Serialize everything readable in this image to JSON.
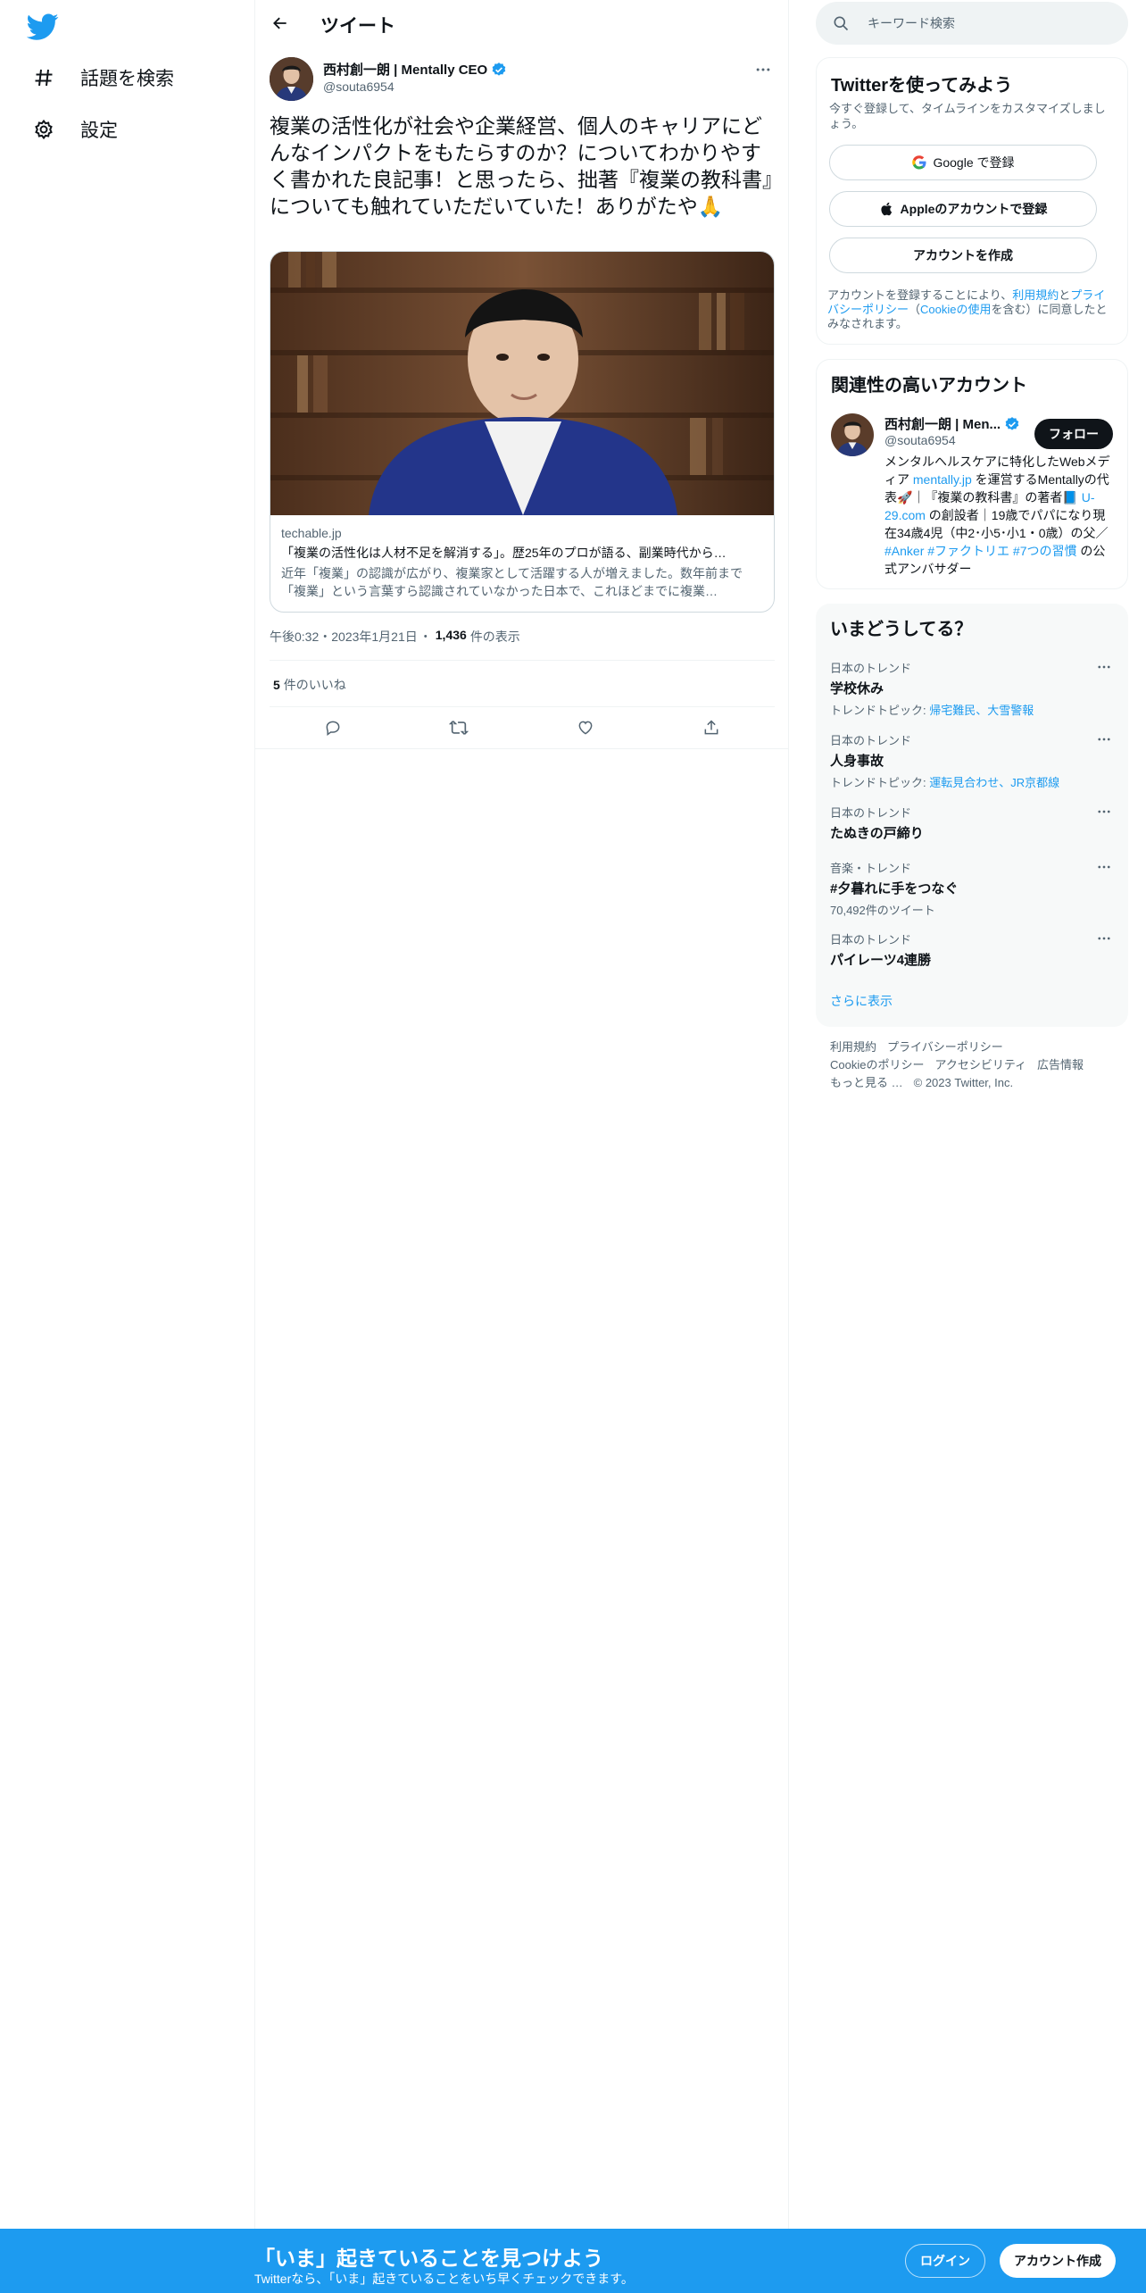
{
  "colors": {
    "accent": "#1d9bf0",
    "text": "#0f1419",
    "secondary": "#536471"
  },
  "nav": {
    "logo_icon": "twitter-bird-icon",
    "items": [
      {
        "label": "話題を検索",
        "icon": "hashtag-icon"
      },
      {
        "label": "設定",
        "icon": "gear-icon"
      }
    ]
  },
  "header": {
    "title": "ツイート",
    "back_icon": "arrow-left-icon"
  },
  "tweet": {
    "author_name": "西村創一朗 | Mentally CEO",
    "author_handle": "@souta6954",
    "text": "複業の活性化が社会や企業経営、個人のキャリアにどんなインパクトをもたらすのか？についてわかりやすく書かれた良記事！と思ったら、拙著『複業の教科書』についても触れていただいていた！ありがたや🙏",
    "card": {
      "domain": "techable.jp",
      "title": "「複業の活性化は人材不足を解消する」。歴25年のプロが語る、副業時代から…",
      "description": "近年「複業」の認識が広がり、複業家として活躍する人が増えました。数年前まで「複業」という言葉すら認識されていなかった日本で、これほどまでに複業…"
    },
    "time": "午後0:32・2023年1月21日",
    "views_count": "1,436",
    "views_label": "件の表示",
    "likes_count": "5",
    "likes_label": "件のいいね"
  },
  "search": {
    "placeholder": "キーワード検索"
  },
  "signup_panel": {
    "title": "Twitterを使ってみよう",
    "subtitle": "今すぐ登録して、タイムラインをカスタマイズしましょう。",
    "google_label": "Google で登録",
    "apple_label": "Appleのアカウントで登録",
    "create_label": "アカウントを作成",
    "legal_prefix": "アカウントを登録することにより、",
    "legal_terms": "利用規約",
    "legal_and": "と",
    "legal_privacy": "プライバシーポリシー",
    "legal_paren_open": "（",
    "legal_cookie": "Cookieの使用",
    "legal_suffix": "を含む）に同意したとみなされます。"
  },
  "relevant": {
    "title": "関連性の高いアカウント",
    "name": "西村創一朗 | Men...",
    "handle": "@souta6954",
    "follow_label": "フォロー",
    "bio_1": "メンタルヘルスケアに特化したWebメディア ",
    "bio_link1": "mentally.jp",
    "bio_2": " を運営するMentallyの代表🚀｜『複業の教科書』の著者📘 ",
    "bio_link2": "U-29.com",
    "bio_3": " の創設者｜19歳でパパになり現在34歳4児（中2･小5･小1・0歳）の父／ ",
    "bio_link3": "#Anker #ファクトリエ #7つの習慣",
    "bio_4": " の公式アンバサダー"
  },
  "trends": {
    "title": "いまどうしてる？",
    "items": [
      {
        "category": "日本のトレンド",
        "name": "学校休み",
        "sub_prefix": "トレンドトピック: ",
        "sub_links": "帰宅難民、大雪警報"
      },
      {
        "category": "日本のトレンド",
        "name": "人身事故",
        "sub_prefix": "トレンドトピック: ",
        "sub_links": "運転見合わせ、JR京都線"
      },
      {
        "category": "日本のトレンド",
        "name": "たぬきの戸締り",
        "sub_prefix": "",
        "sub_links": ""
      },
      {
        "category": "音楽・トレンド",
        "name": "#夕暮れに手をつなぐ",
        "sub_prefix": "70,492件のツイート",
        "sub_links": ""
      },
      {
        "category": "日本のトレンド",
        "name": "パイレーツ4連勝",
        "sub_prefix": "",
        "sub_links": ""
      }
    ],
    "show_more": "さらに表示"
  },
  "footer": {
    "terms": "利用規約",
    "privacy": "プライバシーポリシー",
    "cookie": "Cookieのポリシー",
    "accessibility": "アクセシビリティ",
    "ads": "広告情報",
    "more": "もっと見る …",
    "copyright": "© 2023 Twitter, Inc."
  },
  "bottom_bar": {
    "title": "「いま」起きていることを見つけよう",
    "subtitle": "Twitterなら、「いま」起きていることをいち早くチェックできます。",
    "login_label": "ログイン",
    "signup_label": "アカウント作成"
  }
}
